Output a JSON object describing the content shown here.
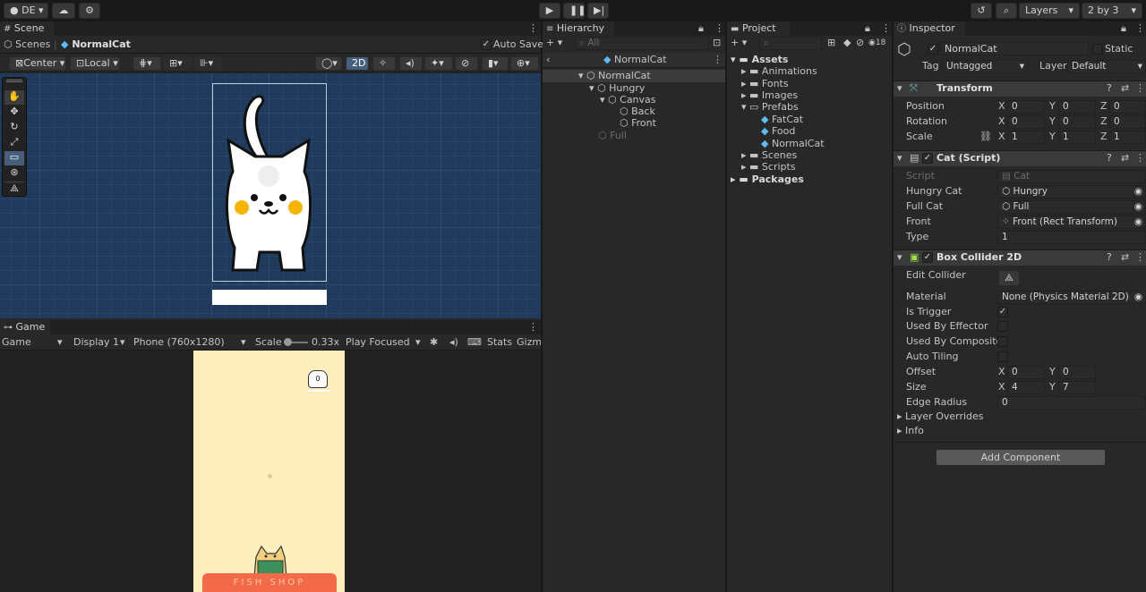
{
  "toolbar": {
    "account": "DE",
    "layers": "Layers",
    "layout": "2 by 3"
  },
  "scene": {
    "tab": "Scene",
    "breadcrumb_root": "Scenes",
    "breadcrumb_current": "NormalCat",
    "auto_save": "Auto Save",
    "pivot": "Center",
    "space": "Local",
    "mode_2d": "2D"
  },
  "game": {
    "tab": "Game",
    "view": "Game",
    "display": "Display 1",
    "resolution": "Phone (760x1280)",
    "scale_label": "Scale",
    "scale_value": "0.33x",
    "play_mode": "Play Focused",
    "stats": "Stats",
    "gizmos": "Gizmos",
    "score": "0",
    "shop_text": "FISH SHOP"
  },
  "hierarchy": {
    "tab": "Hierarchy",
    "search_placeholder": "All",
    "root": "NormalCat",
    "items": [
      {
        "label": "NormalCat"
      },
      {
        "label": "Hungry"
      },
      {
        "label": "Canvas"
      },
      {
        "label": "Back"
      },
      {
        "label": "Front"
      },
      {
        "label": "Full"
      }
    ]
  },
  "project": {
    "tab": "Project",
    "badge": "18",
    "items": [
      {
        "label": "Assets"
      },
      {
        "label": "Animations"
      },
      {
        "label": "Fonts"
      },
      {
        "label": "Images"
      },
      {
        "label": "Prefabs"
      },
      {
        "label": "FatCat"
      },
      {
        "label": "Food"
      },
      {
        "label": "NormalCat"
      },
      {
        "label": "Scenes"
      },
      {
        "label": "Scripts"
      },
      {
        "label": "Packages"
      }
    ]
  },
  "inspector": {
    "tab": "Inspector",
    "object_name": "NormalCat",
    "static": "Static",
    "tag_label": "Tag",
    "tag_value": "Untagged",
    "layer_label": "Layer",
    "layer_value": "Default",
    "transform": {
      "title": "Transform",
      "position_label": "Position",
      "rotation_label": "Rotation",
      "scale_label": "Scale",
      "x": "X",
      "y": "Y",
      "z": "Z",
      "position": [
        "0",
        "0",
        "0"
      ],
      "rotation": [
        "0",
        "0",
        "0"
      ],
      "scale": [
        "1",
        "1",
        "1"
      ]
    },
    "cat_script": {
      "title": "Cat (Script)",
      "script_label": "Script",
      "script_value": "Cat",
      "hungry_label": "Hungry Cat",
      "hungry_value": "Hungry",
      "full_label": "Full Cat",
      "full_value": "Full",
      "front_label": "Front",
      "front_value": "Front (Rect Transform)",
      "type_label": "Type",
      "type_value": "1"
    },
    "box_collider": {
      "title": "Box Collider 2D",
      "edit_label": "Edit Collider",
      "material_label": "Material",
      "material_value": "None (Physics Material 2D)",
      "trigger_label": "Is Trigger",
      "effector_label": "Used By Effector",
      "composite_label": "Used By Composite",
      "tiling_label": "Auto Tiling",
      "offset_label": "Offset",
      "offset_x": "0",
      "offset_y": "0",
      "size_label": "Size",
      "size_x": "4",
      "size_y": "7",
      "edge_label": "Edge Radius",
      "edge_value": "0",
      "overrides_label": "Layer Overrides",
      "info_label": "Info"
    },
    "add_component": "Add Component"
  }
}
